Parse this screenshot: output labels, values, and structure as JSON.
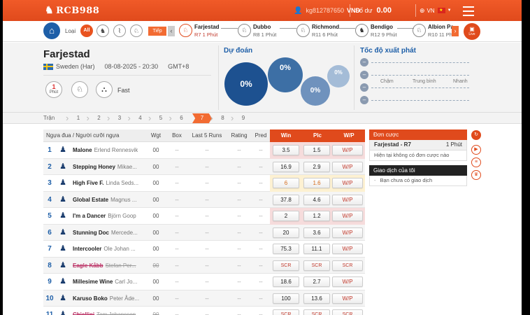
{
  "header": {
    "logo": "RCB988",
    "username": "kg812787650",
    "currency": "VND",
    "balance_label": "Số dư",
    "balance": "0.00",
    "language": "VN",
    "brand_color": "#e04a1c"
  },
  "strip": {
    "type_label": "Loại",
    "all_label": "All",
    "next_label": "Tiếp",
    "live_label": "Live",
    "meetings": [
      {
        "name": "Farjestad",
        "sub": "R7 1 Phút",
        "active": true
      },
      {
        "name": "Dubbo",
        "sub": "R8 1 Phút",
        "active": false
      },
      {
        "name": "Richmond",
        "sub": "R11 6 Phút",
        "active": false
      },
      {
        "name": "Bendigo",
        "sub": "R12 9 Phút",
        "active": false
      },
      {
        "name": "Albion Pa",
        "sub": "R10 11 Phút",
        "active": false
      }
    ]
  },
  "race": {
    "name": "Farjestad",
    "country": "Sweden (Har)",
    "datetime": "08-08-2025 - 20:30",
    "timezone": "GMT+8",
    "minutes_num": "1",
    "minutes_label": "Phút",
    "speed": "Fast"
  },
  "prediction": {
    "title": "Dự đoán",
    "bubbles": [
      "0%",
      "0%",
      "0%",
      "0%"
    ]
  },
  "start_speed": {
    "title": "Tốc độ xuất phát",
    "labels": [
      "Chậm",
      "Trung bình",
      "Nhanh"
    ]
  },
  "racebar": {
    "label": "Trận",
    "numbers": [
      "1",
      "2",
      "3",
      "4",
      "5",
      "6",
      "7",
      "8",
      "9"
    ],
    "active": "7"
  },
  "table": {
    "headers": {
      "runner": "Ngựa đua / Người cưỡi ngựa",
      "wgt": "Wgt",
      "box": "Box",
      "last5": "Last 5 Runs",
      "rating": "Rating",
      "pred": "Pred",
      "win": "Win",
      "plc": "Plc",
      "wp": "W/P"
    },
    "rows": [
      {
        "no": "1",
        "horse": "Malone",
        "jockey": "Erlend Rennesvik",
        "wgt": "00",
        "box": "--",
        "last5": "--",
        "rating": "--",
        "pred": "--",
        "win": "3.5",
        "plc": "1.5",
        "wp": "W/P",
        "hl": "p",
        "scr": false
      },
      {
        "no": "2",
        "horse": "Stepping Honey",
        "jockey": "Mikae...",
        "wgt": "00",
        "box": "--",
        "last5": "--",
        "rating": "--",
        "pred": "--",
        "win": "16.9",
        "plc": "2.9",
        "wp": "W/P",
        "hl": "",
        "scr": false
      },
      {
        "no": "3",
        "horse": "High Five F.",
        "jockey": "Linda Seds...",
        "wgt": "00",
        "box": "--",
        "last5": "--",
        "rating": "--",
        "pred": "--",
        "win": "6",
        "plc": "1.6",
        "wp": "W/P",
        "hl": "y",
        "scr": false
      },
      {
        "no": "4",
        "horse": "Global Estate",
        "jockey": "Magnus ...",
        "wgt": "00",
        "box": "--",
        "last5": "--",
        "rating": "--",
        "pred": "--",
        "win": "37.8",
        "plc": "4.6",
        "wp": "W/P",
        "hl": "",
        "scr": false
      },
      {
        "no": "5",
        "horse": "I'm a Dancer",
        "jockey": "Björn Goop",
        "wgt": "00",
        "box": "--",
        "last5": "--",
        "rating": "--",
        "pred": "--",
        "win": "2",
        "plc": "1.2",
        "wp": "W/P",
        "hl": "p",
        "scr": false
      },
      {
        "no": "6",
        "horse": "Stunning Doc",
        "jockey": "Mercede...",
        "wgt": "00",
        "box": "--",
        "last5": "--",
        "rating": "--",
        "pred": "--",
        "win": "20",
        "plc": "3.6",
        "wp": "W/P",
        "hl": "",
        "scr": false
      },
      {
        "no": "7",
        "horse": "Intercooler",
        "jockey": "Ole Johan ...",
        "wgt": "00",
        "box": "--",
        "last5": "--",
        "rating": "--",
        "pred": "--",
        "win": "75.3",
        "plc": "11.1",
        "wp": "W/P",
        "hl": "",
        "scr": false
      },
      {
        "no": "8",
        "horse": "Eagle Kåbb",
        "jockey": "Stefan Per...",
        "wgt": "00",
        "box": "--",
        "last5": "--",
        "rating": "--",
        "pred": "--",
        "win": "SCR",
        "plc": "SCR",
        "wp": "SCR",
        "hl": "",
        "scr": true
      },
      {
        "no": "9",
        "horse": "Millesime Wine",
        "jockey": "Carl Jo...",
        "wgt": "00",
        "box": "--",
        "last5": "--",
        "rating": "--",
        "pred": "--",
        "win": "18.6",
        "plc": "2.7",
        "wp": "W/P",
        "hl": "",
        "scr": false
      },
      {
        "no": "10",
        "horse": "Karuso Boko",
        "jockey": "Peter Åde...",
        "wgt": "00",
        "box": "--",
        "last5": "--",
        "rating": "--",
        "pred": "--",
        "win": "100",
        "plc": "13.6",
        "wp": "W/P",
        "hl": "",
        "scr": false
      },
      {
        "no": "11",
        "horse": "Chiellini",
        "jockey": "Tom Johansson",
        "wgt": "00",
        "box": "--",
        "last5": "--",
        "rating": "--",
        "pred": "--",
        "win": "SCR",
        "plc": "SCR",
        "wp": "SCR",
        "hl": "",
        "scr": true
      }
    ]
  },
  "side": {
    "betslip_title": "Đơn cược",
    "betslip_race": "Farjestad - R7",
    "betslip_time": "1 Phút",
    "betslip_empty": "Hiện tại không có đơn cược nào",
    "mytx_title": "Giao dịch của tôi",
    "mytx_empty": "Bạn chưa có giao dịch"
  }
}
